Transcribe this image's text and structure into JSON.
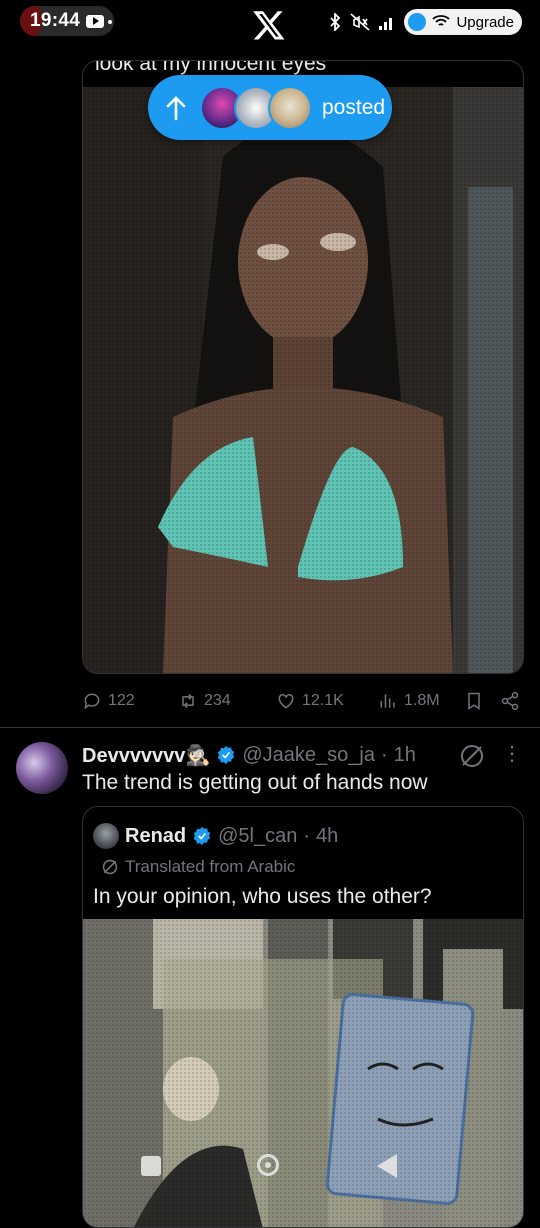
{
  "status_bar": {
    "time": "19:44",
    "right_pill_text": "Upgrade"
  },
  "timeline": {
    "posted_pill": {
      "label": "posted"
    },
    "tweet1": {
      "caption_partial": "look at my innocent eyes",
      "actions": {
        "replies": "122",
        "reposts": "234",
        "likes": "12.1K",
        "views": "1.8M"
      }
    },
    "tweet2": {
      "display_name": "Devvvvvvv",
      "emoji": "🕵🏻",
      "handle": "@Jaake_so_ja",
      "time": "1h",
      "text": "The trend is getting out of hands now",
      "quote": {
        "display_name": "Renad",
        "handle": "@5l_can",
        "time": "4h",
        "translated_label": "Translated from Arabic",
        "text": "In your opinion, who uses the other?"
      }
    }
  },
  "colors": {
    "accent": "#1d9bf0",
    "text": "#e7e9ea",
    "secondary": "#71767b",
    "border": "#2f3336"
  }
}
